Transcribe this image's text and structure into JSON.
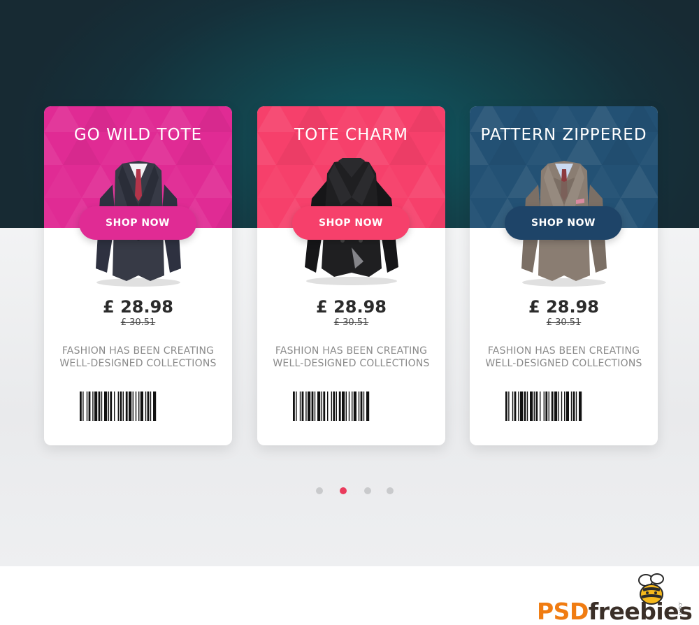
{
  "cards": [
    {
      "title": "GO WILD TOTE",
      "button_label": "SHOP NOW",
      "price": "£ 28.98",
      "old_price": "£ 30.51",
      "description_line1": "FASHION HAS BEEN CREATING",
      "description_line2": "WELL-DESIGNED COLLECTIONS",
      "accent_color": "#e02b94",
      "button_color": "#e02b94",
      "garment": "suit-icon"
    },
    {
      "title": "TOTE CHARM",
      "button_label": "SHOP NOW",
      "price": "£ 28.98",
      "old_price": "£ 30.51",
      "description_line1": "FASHION HAS BEEN CREATING",
      "description_line2": "WELL-DESIGNED COLLECTIONS",
      "accent_color": "#f6406b",
      "button_color": "#f6406b",
      "garment": "peacoat-icon"
    },
    {
      "title": "PATTERN ZIPPERED",
      "button_label": "SHOP NOW",
      "price": "£ 28.98",
      "old_price": "£ 30.51",
      "description_line1": "FASHION HAS BEEN CREATING",
      "description_line2": "WELL-DESIGNED COLLECTIONS",
      "accent_color": "#235174",
      "button_color": "#1e4468",
      "garment": "tweed-blazer-icon"
    }
  ],
  "pagination": {
    "count": 4,
    "active_index": 1,
    "active_color": "#ea3b5c",
    "inactive_color": "#c9cacc"
  },
  "logo": {
    "part1": "PSD",
    "part2": "freebies",
    "suffix": ".com",
    "icon": "bee-icon"
  }
}
